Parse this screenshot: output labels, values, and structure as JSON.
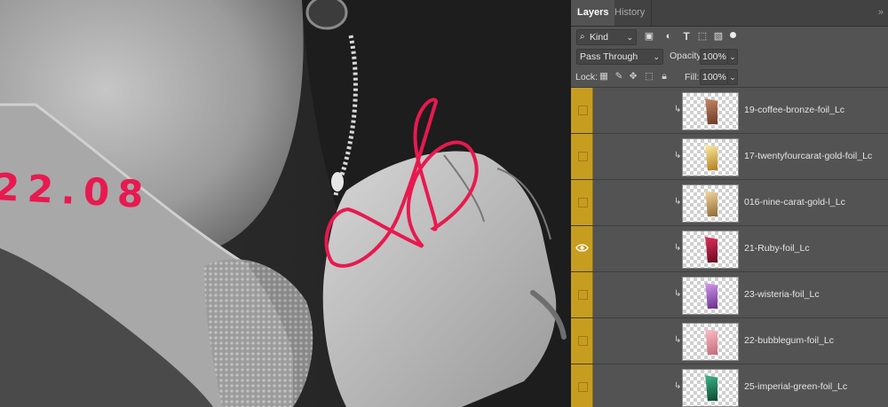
{
  "canvas": {
    "date_text": "22.08",
    "accent_color": "#e8194f"
  },
  "panel": {
    "tabs": [
      {
        "label": "Layers",
        "active": true
      },
      {
        "label": "History",
        "active": false
      }
    ],
    "menu_glyph": "»",
    "filter": {
      "kind_label": "Kind",
      "icons": [
        "image-filter-icon",
        "adjustment-filter-icon",
        "type-filter-icon",
        "shape-filter-icon",
        "smart-object-filter-icon"
      ]
    },
    "blend_mode": "Pass Through",
    "opacity_label": "Opacity:",
    "opacity_value": "100%",
    "lock_label": "Lock:",
    "fill_label": "Fill:",
    "fill_value": "100%",
    "group_color": "#c79d20"
  },
  "layers": [
    {
      "name": "19-coffee-bronze-foil_Lc",
      "visible": false,
      "swatch": [
        "#c98a6a",
        "#6b3a25"
      ]
    },
    {
      "name": "17-twentyfourcarat-gold-foil_Lc",
      "visible": false,
      "swatch": [
        "#fff1a3",
        "#b07d1e"
      ]
    },
    {
      "name": "016-nine-carat-gold-l_Lc",
      "visible": false,
      "swatch": [
        "#f6d9a2",
        "#8e6a32"
      ]
    },
    {
      "name": "21-Ruby-foil_Lc",
      "visible": true,
      "swatch": [
        "#e0305a",
        "#6a0a22"
      ]
    },
    {
      "name": "23-wisteria-foil_Lc",
      "visible": false,
      "swatch": [
        "#d49cf0",
        "#6a2e8e"
      ]
    },
    {
      "name": "22-bubblegum-foil_Lc",
      "visible": false,
      "swatch": [
        "#ffc0c8",
        "#c46a7a"
      ]
    },
    {
      "name": "25-imperial-green-foil_Lc",
      "visible": false,
      "swatch": [
        "#3db88a",
        "#0b4a32"
      ]
    }
  ]
}
